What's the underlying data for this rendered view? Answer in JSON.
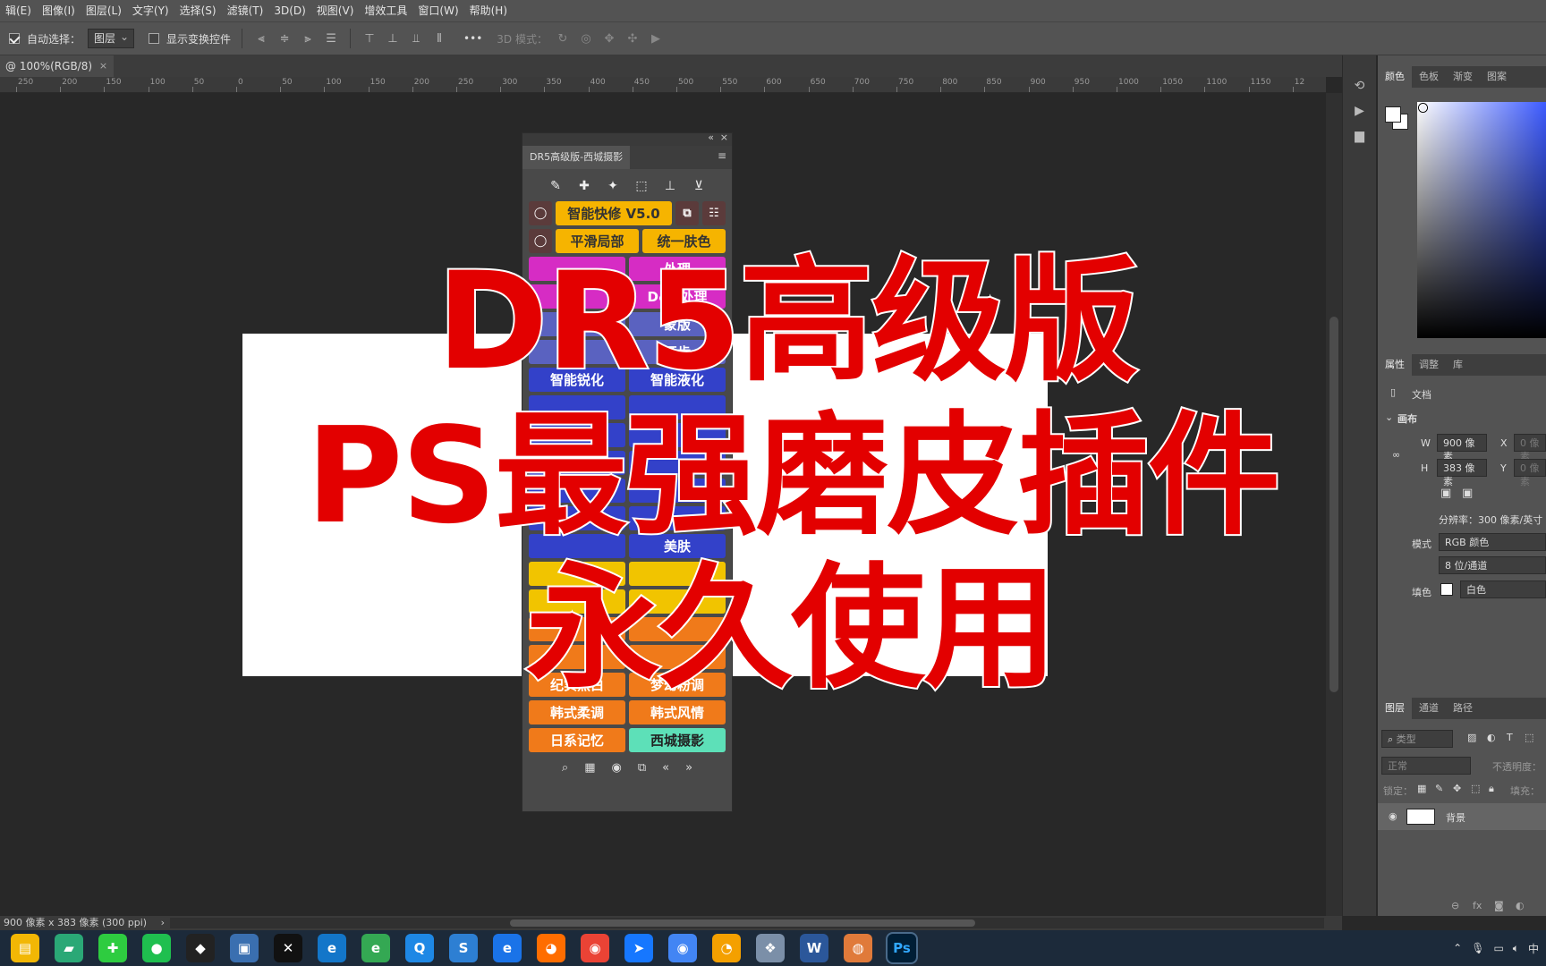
{
  "menu": [
    "辑(E)",
    "图像(I)",
    "图层(L)",
    "文字(Y)",
    "选择(S)",
    "滤镜(T)",
    "3D(D)",
    "视图(V)",
    "增效工具",
    "窗口(W)",
    "帮助(H)"
  ],
  "options": {
    "auto_select_label": "自动选择：",
    "auto_select_value": "图层",
    "show_transform_label": "显示变换控件",
    "mode3d_label": "3D 模式：",
    "more": "•••"
  },
  "doc_tab": {
    "title": "@ 100%(RGB/8)",
    "close": "×"
  },
  "ruler_labels": [
    "250",
    "200",
    "150",
    "100",
    "50",
    "0",
    "50",
    "100",
    "150",
    "200",
    "250",
    "300",
    "350",
    "400",
    "450",
    "500",
    "550",
    "600",
    "650",
    "700",
    "750",
    "800",
    "850",
    "900",
    "950",
    "1000",
    "1050",
    "1100",
    "1150",
    "12"
  ],
  "plugin": {
    "tab_title": "DR5高级版-西城摄影",
    "rows": [
      {
        "a": "智能快修 V5.0",
        "ac": "y"
      },
      {
        "a": "平滑局部",
        "ac": "y",
        "b": "统一肤色",
        "bc": "y"
      },
      {
        "a": "",
        "ac": "pk",
        "b": "处理",
        "bc": "pk"
      },
      {
        "a": "",
        "ac": "pk",
        "b": "D&B处理",
        "bc": "pk"
      },
      {
        "a": "",
        "ac": "gy",
        "b": "蒙版",
        "bc": "gy"
      },
      {
        "a": "",
        "ac": "gy",
        "b": "开齿",
        "bc": "gy"
      },
      {
        "a": "智能锐化",
        "ac": "bl",
        "b": "智能液化",
        "bc": "bl"
      },
      {
        "a": "",
        "ac": "bl",
        "b": "",
        "bc": "bl"
      },
      {
        "a": "",
        "ac": "bl",
        "b": "",
        "bc": "bl"
      },
      {
        "a": "",
        "ac": "bl",
        "b": "",
        "bc": "bl"
      },
      {
        "a": "",
        "ac": "bl",
        "b": "",
        "bc": "bl"
      },
      {
        "a": "",
        "ac": "bl",
        "b": "",
        "bc": "bl"
      },
      {
        "a": "",
        "ac": "bl",
        "b": "美肤",
        "bc": "bl"
      },
      {
        "a": "",
        "ac": "ye",
        "b": "",
        "bc": "ye"
      },
      {
        "a": "",
        "ac": "ye",
        "b": "",
        "bc": "ye"
      },
      {
        "a": "",
        "ac": "or",
        "b": "",
        "bc": "or"
      },
      {
        "a": "",
        "ac": "or",
        "b": "",
        "bc": "or"
      },
      {
        "a": "纪实黑白",
        "ac": "or",
        "b": "梦幻粉调",
        "bc": "or"
      },
      {
        "a": "韩式柔调",
        "ac": "or",
        "b": "韩式风情",
        "bc": "or"
      },
      {
        "a": "日系记忆",
        "ac": "or",
        "b": "西城摄影",
        "bc": "mint"
      }
    ]
  },
  "overlay": {
    "line1": "DR5高级版",
    "line2": "PS最强磨皮插件",
    "line3": "永久使用"
  },
  "color_tabs": [
    "颜色",
    "色板",
    "渐变",
    "图案"
  ],
  "props_tabs": [
    "属性",
    "调整",
    "库"
  ],
  "props": {
    "doc_label": "文档",
    "canvas_label": "画布",
    "w_label": "W",
    "w_value": "900 像素",
    "x_label": "X",
    "x_value": "0 像素",
    "h_label": "H",
    "h_value": "383 像素",
    "y_label": "Y",
    "y_value": "0 像素",
    "resolution": "分辨率：300 像素/英寸",
    "mode_label": "模式",
    "mode_value": "RGB 颜色",
    "depth_value": "8 位/通道",
    "fill_label": "填色",
    "fill_value": "白色"
  },
  "layers_tabs": [
    "图层",
    "通道",
    "路径"
  ],
  "layers": {
    "search_placeholder": "类型",
    "blend": "正常",
    "opacity_label": "不透明度：",
    "lock_label": "锁定：",
    "fill_label": "填充：",
    "layer_name": "背景"
  },
  "status": {
    "text": "900 像素 x 383 像素 (300 ppi)"
  },
  "taskbar_icons": [
    "file-explorer",
    "notepad",
    "360-security",
    "wechat",
    "qq",
    "media",
    "capcut",
    "edge",
    "browser-360",
    "search",
    "sogou",
    "ie",
    "firefox",
    "chrome-like",
    "dingtalk",
    "chrome",
    "browser-orange",
    "network",
    "word",
    "rabbit",
    "photoshop"
  ],
  "tray": {
    "ime": "中"
  },
  "colors": {
    "overlay_red": "#e30000",
    "ps_bg": "#282828",
    "panel": "#535353"
  }
}
